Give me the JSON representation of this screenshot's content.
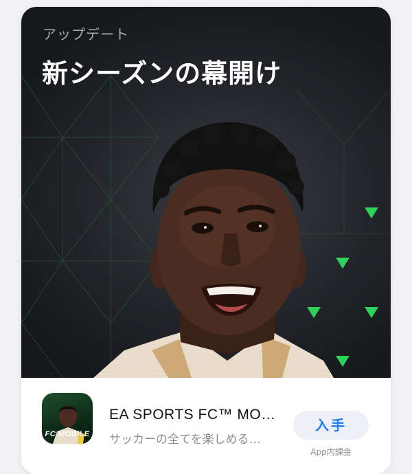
{
  "story": {
    "eyebrow": "アップデート",
    "headline": "新シーズンの幕開け"
  },
  "app": {
    "name": "EA SPORTS FC™ MO…",
    "subtitle": "サッカーの全てを楽しめる…",
    "get_label": "入手",
    "iap_note": "App内課金",
    "icon_text": "FC MOBILE"
  },
  "colors": {
    "accent_green": "#2fd15a",
    "button_text": "#1f7cf5",
    "button_bg": "#eef0f5"
  },
  "icons": {
    "hero_art": "soccer-player-artwork",
    "app_icon": "ea-sports-fc-mobile-icon"
  }
}
